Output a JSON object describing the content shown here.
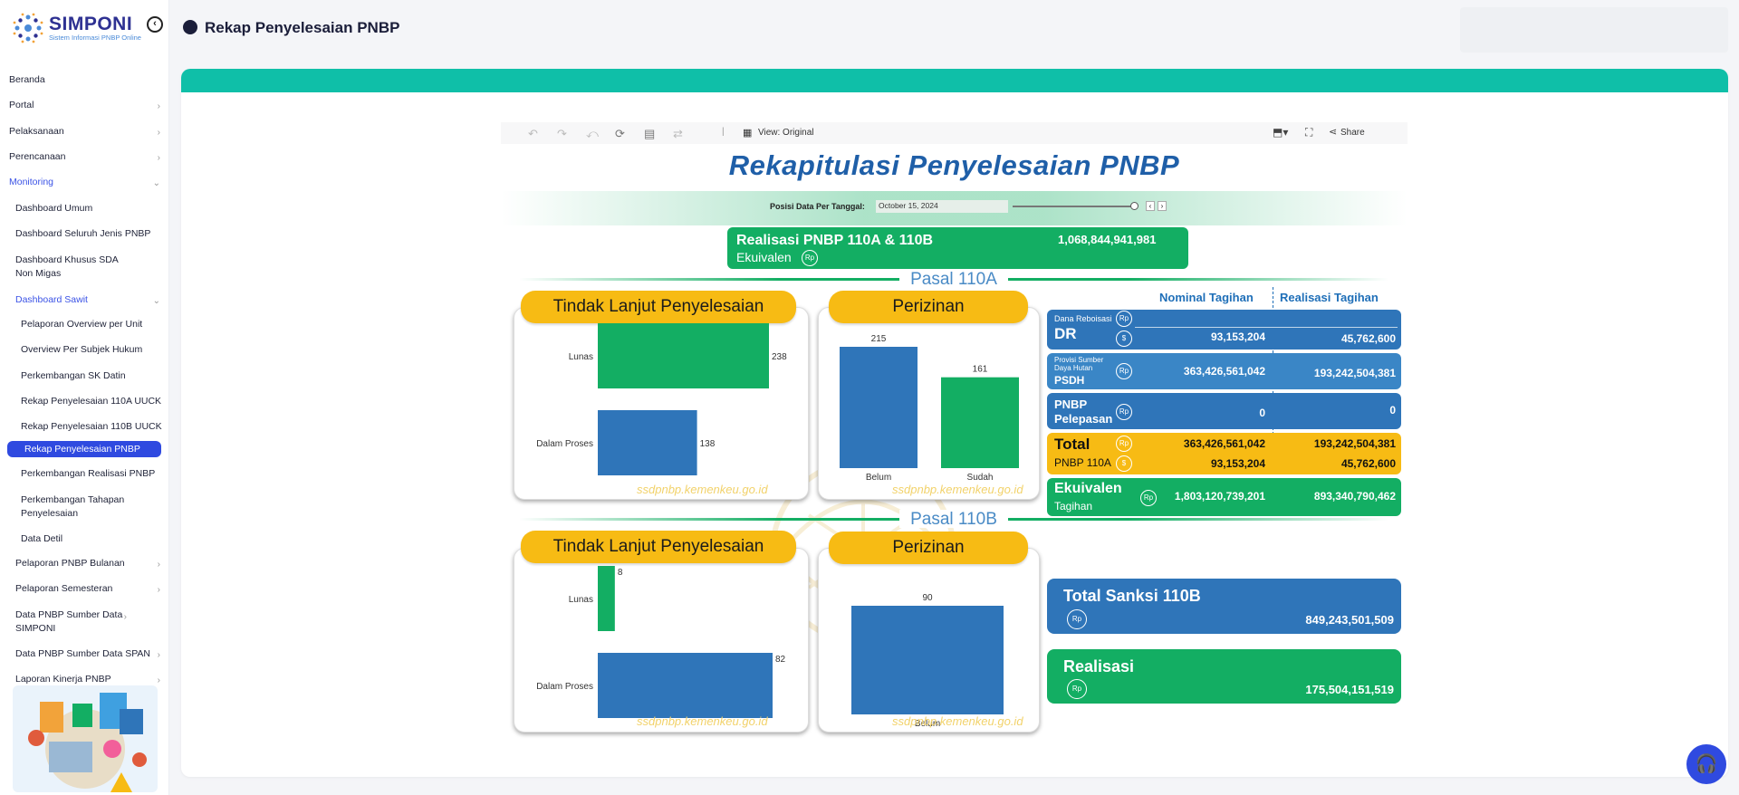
{
  "app": {
    "name": "SIMPONI",
    "subtitle": "Sistem Informasi PNBP Online"
  },
  "header": {
    "title": "Rekap Penyelesaian PNBP"
  },
  "sidebar": {
    "items": [
      {
        "label": "Beranda",
        "chev": ""
      },
      {
        "label": "Portal",
        "chev": "›"
      },
      {
        "label": "Pelaksanaan",
        "chev": "›"
      },
      {
        "label": "Perencanaan",
        "chev": "›"
      },
      {
        "label": "Monitoring",
        "chev": "⌄"
      },
      {
        "label": "Dashboard Umum",
        "chev": ""
      },
      {
        "label": "Dashboard Seluruh Jenis PNBP",
        "chev": ""
      },
      {
        "label": "Dashboard Khusus SDA Non Migas",
        "chev": ""
      },
      {
        "label": "Dashboard Sawit",
        "chev": "⌄"
      },
      {
        "label": "Pelaporan Overview per Unit",
        "chev": ""
      },
      {
        "label": "Overview Per Subjek Hukum",
        "chev": ""
      },
      {
        "label": "Perkembangan SK Datin",
        "chev": ""
      },
      {
        "label": "Rekap Penyelesaian 110A UUCK",
        "chev": ""
      },
      {
        "label": "Rekap Penyelesaian 110B UUCK",
        "chev": ""
      },
      {
        "label": "Rekap Penyelesaian PNBP",
        "chev": ""
      },
      {
        "label": "Perkembangan Realisasi PNBP",
        "chev": ""
      },
      {
        "label": "Perkembangan Tahapan Penyelesaian",
        "chev": ""
      },
      {
        "label": "Data Detil",
        "chev": ""
      },
      {
        "label": "Pelaporan PNBP Bulanan",
        "chev": "›"
      },
      {
        "label": "Pelaporan Semesteran",
        "chev": "›"
      },
      {
        "label": "Data PNBP Sumber Data SIMPONI",
        "chev": "›"
      },
      {
        "label": "Data PNBP Sumber Data SPAN",
        "chev": "›"
      },
      {
        "label": "Laporan Kinerja PNBP",
        "chev": "›"
      }
    ]
  },
  "toolbar": {
    "view": "View: Original",
    "share": "Share"
  },
  "dashboard": {
    "title": "Rekapitulasi Penyelesaian PNBP",
    "date_label": "Posisi Data Per Tanggal:",
    "date_value": "October 15, 2024",
    "realisasi_title": "Realisasi PNBP 110A & 110B",
    "realisasi_sub": "Ekuivalen",
    "realisasi_value": "1,068,844,941,981",
    "pasal_110a": "Pasal 110A",
    "pasal_110b": "Pasal 110B",
    "tindak_lanjut": "Tindak Lanjut Penyelesaian",
    "perizinan": "Perizinan",
    "watermark": "ssdpnbp.kemenkeu.go.id",
    "col_nominal": "Nominal Tagihan",
    "col_realisasi": "Realisasi Tagihan",
    "rows": {
      "dr": {
        "small": "Dana Reboisasi",
        "big": "DR",
        "nominal": "93,153,204",
        "realisasi": "45,762,600"
      },
      "psdh": {
        "small": "Provisi Sumber Daya Hutan",
        "big": "PSDH",
        "nominal": "363,426,561,042",
        "realisasi": "193,242,504,381"
      },
      "pelepasan": {
        "big": "PNBP",
        "big2": "Pelepasan",
        "nominal": "0",
        "realisasi": "0"
      },
      "total": {
        "big": "Total",
        "small": "PNBP 110A",
        "nominal_rp": "363,426,561,042",
        "nominal_usd": "93,153,204",
        "realisasi_rp": "193,242,504,381",
        "realisasi_usd": "45,762,600"
      },
      "ekuivalen": {
        "big": "Ekuivalen",
        "small": "Tagihan",
        "nominal": "1,803,120,739,201",
        "realisasi": "893,340,790,462"
      }
    },
    "sanksi_title": "Total Sanksi 110B",
    "sanksi_value": "849,243,501,509",
    "realisasi2_title": "Realisasi",
    "realisasi2_value": "175,504,151,519",
    "rp": "Rp",
    "usd": "$"
  },
  "chart_data": [
    {
      "type": "bar",
      "orientation": "horizontal",
      "title": "Tindak Lanjut Penyelesaian",
      "section": "Pasal 110A",
      "categories": [
        "Lunas",
        "Dalam Proses"
      ],
      "values": [
        238,
        138
      ],
      "colors": [
        "#13ae63",
        "#2f75b9"
      ]
    },
    {
      "type": "bar",
      "title": "Perizinan",
      "section": "Pasal 110A",
      "categories": [
        "Belum",
        "Sudah"
      ],
      "values": [
        215,
        161
      ],
      "colors": [
        "#2f75b9",
        "#13ae63"
      ]
    },
    {
      "type": "bar",
      "orientation": "horizontal",
      "title": "Tindak Lanjut Penyelesaian",
      "section": "Pasal 110B",
      "categories": [
        "Lunas",
        "Dalam Proses"
      ],
      "values": [
        8,
        82
      ],
      "colors": [
        "#13ae63",
        "#2f75b9"
      ]
    },
    {
      "type": "bar",
      "title": "Perizinan",
      "section": "Pasal 110B",
      "categories": [
        "Belum"
      ],
      "values": [
        90
      ],
      "colors": [
        "#2f75b9"
      ]
    }
  ],
  "colors": {
    "teal": "#0fbfa8",
    "navy_blue": "#2f4ae0",
    "yellow": "#f7bb14",
    "green": "#13ae63",
    "blue": "#2f75b9"
  }
}
